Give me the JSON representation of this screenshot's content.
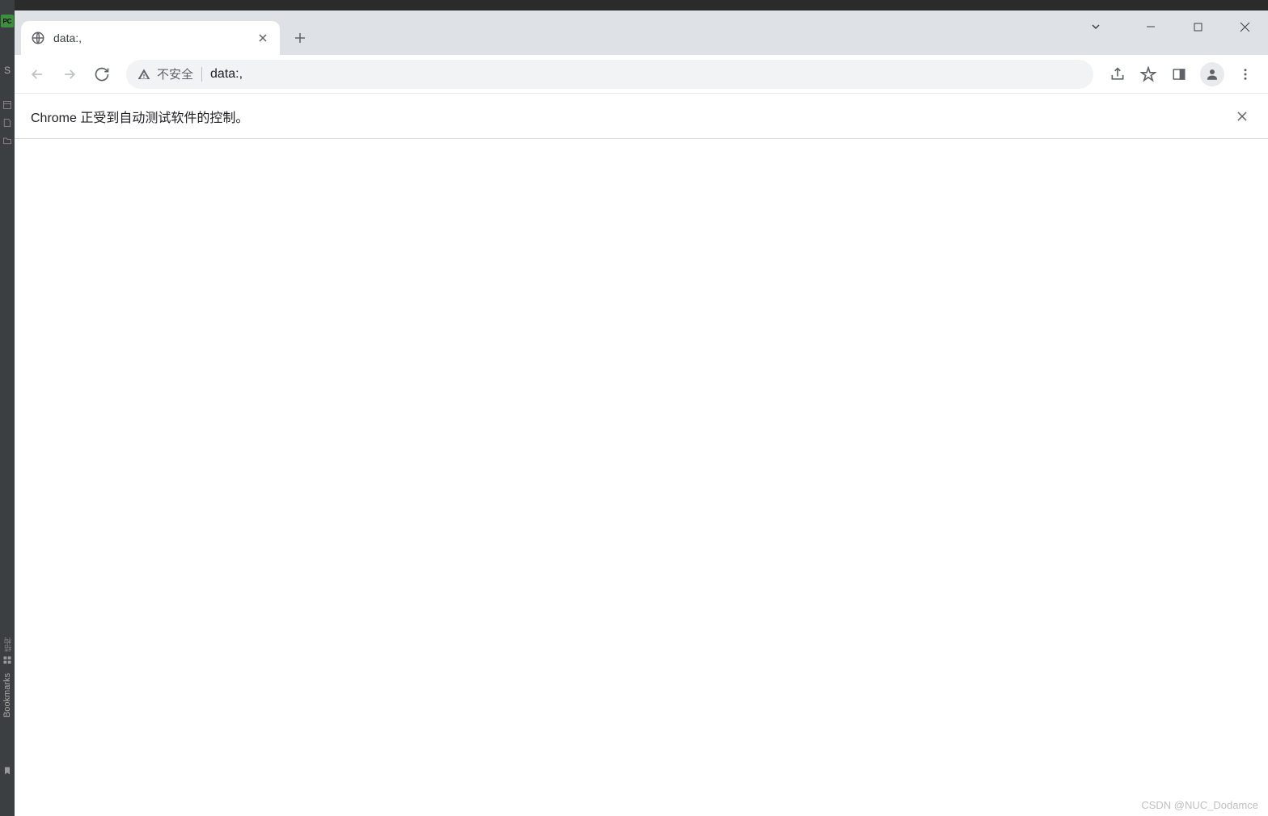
{
  "ide": {
    "badge_text": "PC",
    "side_label": "Bookmarks",
    "letter_s": "S"
  },
  "browser": {
    "tab": {
      "title": "data:,",
      "favicon": "globe-icon"
    },
    "address_bar": {
      "security_text": "不安全",
      "url": "data:,"
    },
    "infobar": {
      "message": "Chrome 正受到自动测试软件的控制。"
    }
  },
  "watermark": "CSDN @NUC_Dodamce"
}
